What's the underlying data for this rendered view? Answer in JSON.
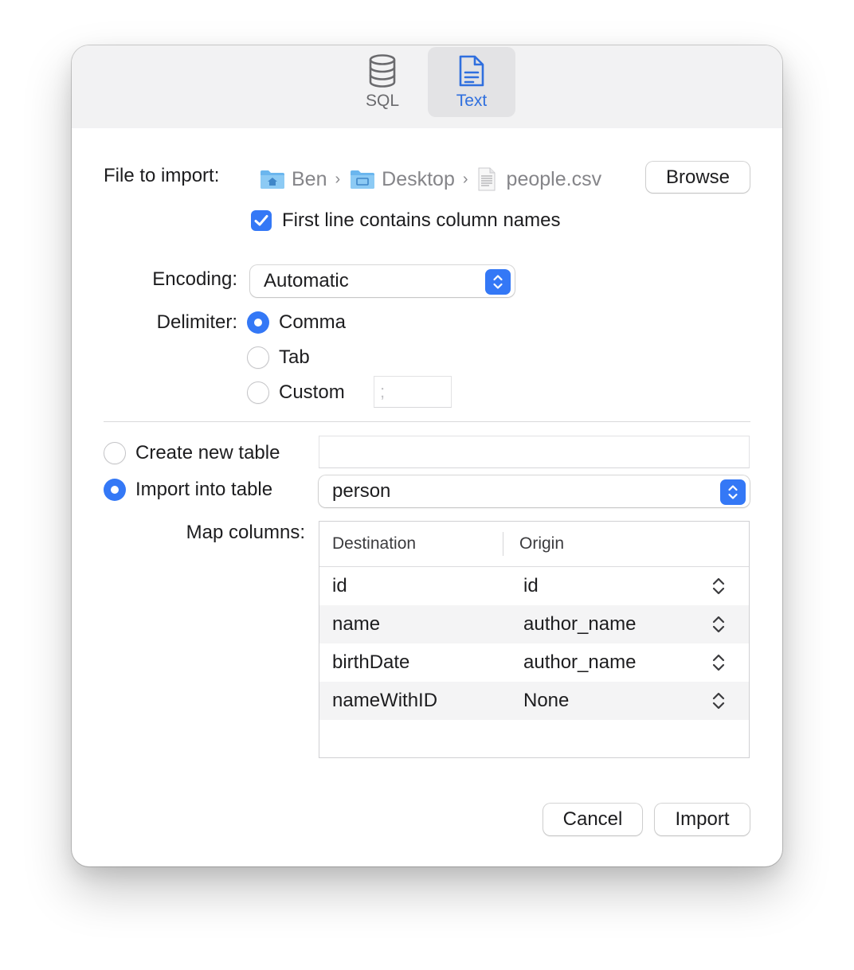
{
  "toolbar": {
    "tabs": [
      {
        "label": "SQL",
        "icon": "database-icon",
        "selected": false
      },
      {
        "label": "Text",
        "icon": "document-icon",
        "selected": true
      }
    ]
  },
  "file": {
    "label": "File to import:",
    "path": [
      {
        "name": "Ben",
        "icon": "home-folder-icon"
      },
      {
        "name": "Desktop",
        "icon": "desktop-folder-icon"
      },
      {
        "name": "people.csv",
        "icon": "csv-file-icon"
      }
    ],
    "browse_label": "Browse"
  },
  "header_option": {
    "label": "First line contains column names",
    "checked": true
  },
  "encoding": {
    "label": "Encoding:",
    "value": "Automatic"
  },
  "delimiter": {
    "label": "Delimiter:",
    "options": [
      {
        "label": "Comma",
        "selected": true
      },
      {
        "label": "Tab",
        "selected": false
      },
      {
        "label": "Custom",
        "selected": false
      }
    ],
    "custom_placeholder": ";"
  },
  "table_target": {
    "create_label": "Create new table",
    "create_selected": false,
    "new_table_name": "",
    "import_label": "Import into table",
    "import_selected": true,
    "table_value": "person"
  },
  "map_columns": {
    "label": "Map columns:",
    "headers": [
      "Destination",
      "Origin"
    ],
    "rows": [
      {
        "destination": "id",
        "origin": "id"
      },
      {
        "destination": "name",
        "origin": "author_name"
      },
      {
        "destination": "birthDate",
        "origin": "author_name"
      },
      {
        "destination": "nameWithID",
        "origin": "None"
      }
    ]
  },
  "actions": {
    "cancel_label": "Cancel",
    "import_label": "Import"
  },
  "colors": {
    "accent": "#3478f6",
    "selected_tab_text": "#2f6fde",
    "toolbar_bg": "#f2f2f3"
  }
}
